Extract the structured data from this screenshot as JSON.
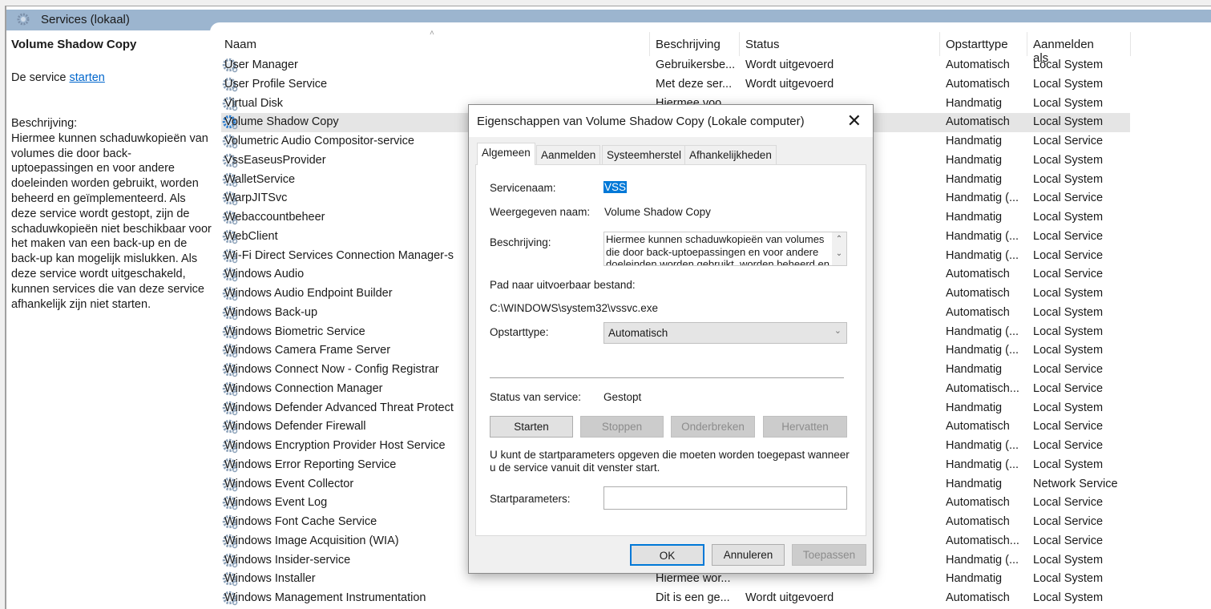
{
  "window": {
    "title": "Services (lokaal)"
  },
  "left": {
    "title": "Volume Shadow Copy",
    "start_prefix": "De service ",
    "start_link": "starten",
    "desc_label": "Beschrijving:",
    "desc": "Hiermee kunnen schaduwkopieën van volumes die door back-uptoepassingen en voor andere doeleinden worden gebruikt,  worden beheerd en geïmplementeerd. Als deze service wordt gestopt, zijn de schaduwkopieën niet beschikbaar voor het maken van een back-up en de back-up kan mogelijk mislukken. Als deze service wordt uitgeschakeld, kunnen services die van deze service afhankelijk zijn niet starten."
  },
  "columns": [
    "Naam",
    "Beschrijving",
    "Status",
    "Opstarttype",
    "Aanmelden als"
  ],
  "rows": [
    [
      "User Manager",
      "Gebruikersbe...",
      "Wordt uitgevoerd",
      "Automatisch",
      "Local System"
    ],
    [
      "User Profile Service",
      "Met deze ser...",
      "Wordt uitgevoerd",
      "Automatisch",
      "Local System"
    ],
    [
      "Virtual Disk",
      "Hiermee voo...",
      "",
      "Handmatig",
      "Local System"
    ],
    [
      "Volume Shadow Copy",
      "",
      "",
      "Automatisch",
      "Local System"
    ],
    [
      "Volumetric Audio Compositor-service",
      "",
      "",
      "Handmatig",
      "Local Service"
    ],
    [
      "VssEaseusProvider",
      "",
      "",
      "Handmatig",
      "Local System"
    ],
    [
      "WalletService",
      "",
      "",
      "Handmatig",
      "Local System"
    ],
    [
      "WarpJITSvc",
      "",
      "",
      "Handmatig (...",
      "Local Service"
    ],
    [
      "Webaccountbeheer",
      "",
      "",
      "Handmatig",
      "Local System"
    ],
    [
      "WebClient",
      "",
      "",
      "Handmatig (...",
      "Local Service"
    ],
    [
      "Wi-Fi Direct Services Connection Manager-s",
      "",
      "",
      "Handmatig (...",
      "Local Service"
    ],
    [
      "Windows Audio",
      "",
      "",
      "Automatisch",
      "Local Service"
    ],
    [
      "Windows Audio Endpoint Builder",
      "",
      "",
      "Automatisch",
      "Local System"
    ],
    [
      "Windows Back-up",
      "",
      "",
      "Automatisch",
      "Local System"
    ],
    [
      "Windows Biometric Service",
      "",
      "",
      "Handmatig (...",
      "Local System"
    ],
    [
      "Windows Camera Frame Server",
      "",
      "",
      "Handmatig (...",
      "Local System"
    ],
    [
      "Windows Connect Now - Config Registrar",
      "",
      "",
      "Handmatig",
      "Local Service"
    ],
    [
      "Windows Connection Manager",
      "",
      "",
      "Automatisch...",
      "Local Service"
    ],
    [
      "Windows Defender Advanced Threat Protect",
      "",
      "",
      "Handmatig",
      "Local System"
    ],
    [
      "Windows Defender Firewall",
      "",
      "",
      "Automatisch",
      "Local Service"
    ],
    [
      "Windows Encryption Provider Host Service",
      "",
      "",
      "Handmatig (...",
      "Local Service"
    ],
    [
      "Windows Error Reporting Service",
      "",
      "",
      "Handmatig (...",
      "Local System"
    ],
    [
      "Windows Event Collector",
      "",
      "",
      "Handmatig",
      "Network Service"
    ],
    [
      "Windows Event Log",
      "",
      "",
      "Automatisch",
      "Local Service"
    ],
    [
      "Windows Font Cache Service",
      "",
      "",
      "Automatisch",
      "Local Service"
    ],
    [
      "Windows Image Acquisition (WIA)",
      "",
      "",
      "Automatisch...",
      "Local Service"
    ],
    [
      "Windows Insider-service",
      "",
      "",
      "Handmatig (...",
      "Local System"
    ],
    [
      "Windows Installer",
      "Hiermee wor...",
      "",
      "Handmatig",
      "Local System"
    ],
    [
      "Windows Management Instrumentation",
      "Dit is een ge...",
      "Wordt uitgevoerd",
      "Automatisch",
      "Local System"
    ]
  ],
  "selected_row": 3,
  "dialog": {
    "title": "Eigenschappen van Volume Shadow Copy (Lokale computer)",
    "close": "✕",
    "tabs": [
      "Algemeen",
      "Aanmelden",
      "Systeemherstel",
      "Afhankelijkheden"
    ],
    "servicename_label": "Servicenaam:",
    "servicename": "VSS",
    "display_label": "Weergegeven naam:",
    "display": "Volume Shadow Copy",
    "desc_label": "Beschrijving:",
    "desc": "Hiermee kunnen schaduwkopieën van volumes die door back-uptoepassingen en voor andere doeleinden worden gebruikt,  worden beheerd en geïmplementeerd.",
    "path_label": "Pad naar uitvoerbaar bestand:",
    "path": "C:\\WINDOWS\\system32\\vssvc.exe",
    "startup_label": "Opstarttype:",
    "startup": "Automatisch",
    "status_label": "Status van service:",
    "status": "Gestopt",
    "btn_start": "Starten",
    "btn_stop": "Stoppen",
    "btn_pause": "Onderbreken",
    "btn_resume": "Hervatten",
    "hint": "U kunt de startparameters opgeven die moeten worden toegepast wanneer u de service vanuit dit venster start.",
    "params_label": "Startparameters:",
    "params": "",
    "ok": "OK",
    "cancel": "Annuleren",
    "apply": "Toepassen"
  },
  "colors": {
    "accent": "#0078d7",
    "titlebar": "#9cb5cf"
  }
}
